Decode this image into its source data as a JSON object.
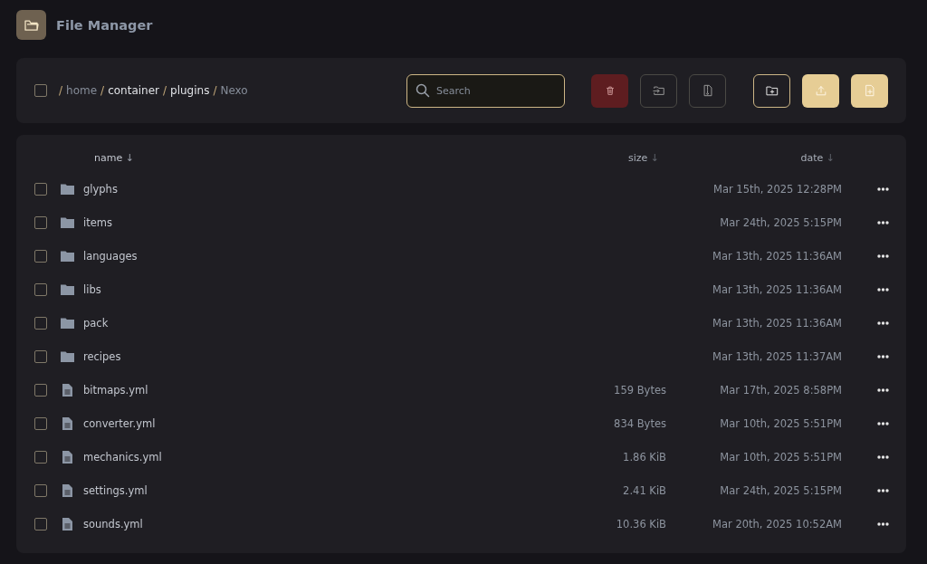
{
  "app": {
    "title": "File Manager"
  },
  "toolbar": {
    "select_all": {
      "checked": false
    },
    "breadcrumb": [
      {
        "separator": "/",
        "label": "home",
        "dim": true
      },
      {
        "separator": "/",
        "label": "container",
        "dim": false
      },
      {
        "separator": "/",
        "label": "plugins",
        "dim": false
      },
      {
        "separator": "/",
        "label": "Nexo",
        "dim": true
      }
    ],
    "search": {
      "placeholder": "Search"
    },
    "buttons": [
      {
        "kind": "delete"
      },
      {
        "kind": "move"
      },
      {
        "kind": "archive"
      },
      {
        "kind": "new-folder"
      },
      {
        "kind": "upload"
      },
      {
        "kind": "new-file"
      }
    ]
  },
  "table": {
    "columns": [
      {
        "label": "name",
        "sort_arrow": "↓"
      },
      {
        "label": "size",
        "sort_arrow": "↓"
      },
      {
        "label": "date",
        "sort_arrow": "↓"
      }
    ],
    "rows": [
      {
        "kind": "folder",
        "name": "glyphs",
        "size": "",
        "date": "Mar 15th, 2025 12:28PM",
        "checked": false
      },
      {
        "kind": "folder",
        "name": "items",
        "size": "",
        "date": "Mar 24th, 2025 5:15PM",
        "checked": false
      },
      {
        "kind": "folder",
        "name": "languages",
        "size": "",
        "date": "Mar 13th, 2025 11:36AM",
        "checked": false
      },
      {
        "kind": "folder",
        "name": "libs",
        "size": "",
        "date": "Mar 13th, 2025 11:36AM",
        "checked": false
      },
      {
        "kind": "folder",
        "name": "pack",
        "size": "",
        "date": "Mar 13th, 2025 11:36AM",
        "checked": false
      },
      {
        "kind": "folder",
        "name": "recipes",
        "size": "",
        "date": "Mar 13th, 2025 11:37AM",
        "checked": false
      },
      {
        "kind": "file",
        "name": "bitmaps.yml",
        "size": "159 Bytes",
        "date": "Mar 17th, 2025 8:58PM",
        "checked": false
      },
      {
        "kind": "file",
        "name": "converter.yml",
        "size": "834 Bytes",
        "date": "Mar 10th, 2025 5:51PM",
        "checked": false
      },
      {
        "kind": "file",
        "name": "mechanics.yml",
        "size": "1.86 KiB",
        "date": "Mar 10th, 2025 5:51PM",
        "checked": false
      },
      {
        "kind": "file",
        "name": "settings.yml",
        "size": "2.41 KiB",
        "date": "Mar 24th, 2025 5:15PM",
        "checked": false
      },
      {
        "kind": "file",
        "name": "sounds.yml",
        "size": "10.36 KiB",
        "date": "Mar 20th, 2025 10:52AM",
        "checked": false
      }
    ]
  }
}
